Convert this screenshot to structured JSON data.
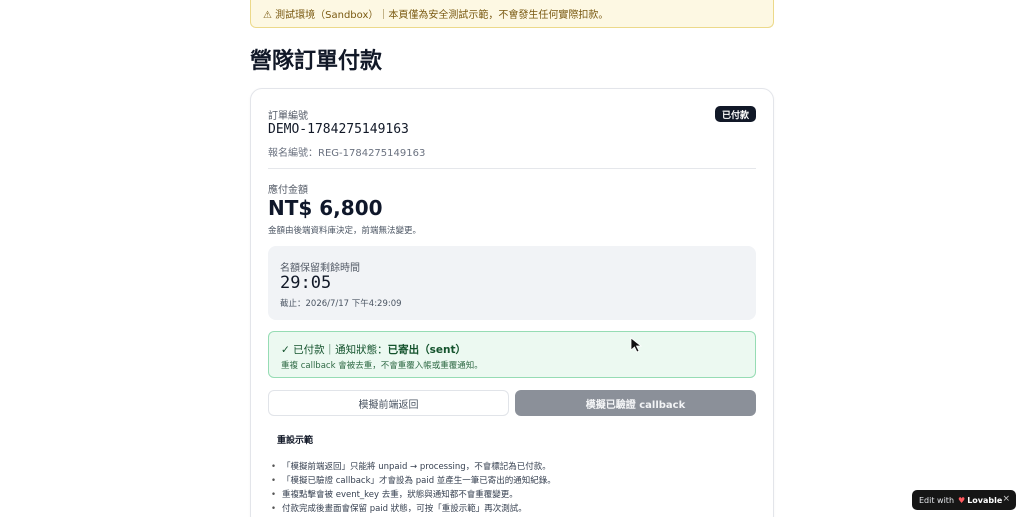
{
  "banner": {
    "icon": "warning-icon",
    "text": "⚠ 測試環境（Sandbox）｜本頁僅為安全測試示範，不會發生任何實際扣款。"
  },
  "page": {
    "title": "營隊訂單付款"
  },
  "order": {
    "label": "訂單編號",
    "number": "DEMO-1784275149163",
    "registration": "報名編號：REG-1784275149163",
    "status_badge": "已付款"
  },
  "amount": {
    "label": "應付金額",
    "value": "NT$ 6,800",
    "note": "金額由後端資料庫決定，前端無法變更。"
  },
  "timer": {
    "label": "名額保留剩餘時間",
    "remaining": "29:05",
    "deadline": "截止：2026/7/17 下午4:29:09"
  },
  "status": {
    "check_icon": "check-icon",
    "prefix": "✓ 已付款｜通知狀態：",
    "state": "已寄出（sent）",
    "note": "重複 callback 會被去重，不會重覆入帳或重覆通知。"
  },
  "buttons": {
    "frontend_return": "模擬前端返回",
    "verified_callback": "模擬已驗證 callback"
  },
  "reset": {
    "title": "重設示範",
    "notes": [
      "「模擬前端返回」只能將 unpaid → processing，不會標記為已付款。",
      "「模擬已驗證 callback」才會設為 paid 並產生一筆已寄出的通知紀錄。",
      "重複點擊會被 event_key 去重，狀態與通知都不會重覆變更。",
      "付款完成後畫面會保留 paid 狀態，可按「重設示範」再次測試。"
    ]
  },
  "lovable": {
    "prefix": "Edit with",
    "brand": "Lovable",
    "close": "×"
  },
  "colors": {
    "badge_bg": "#111827",
    "success_bg": "#ecf9f1",
    "success_border": "#96dcb4",
    "banner_bg": "#fdf8e3",
    "disabled_button": "#8b9099"
  }
}
